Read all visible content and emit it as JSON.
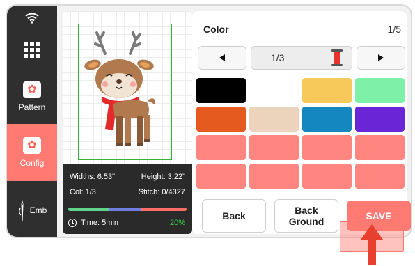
{
  "sidebar": {
    "items": [
      {
        "icon": "wifi-icon"
      },
      {
        "icon": "apps-grid-icon"
      },
      {
        "label": "Pattern",
        "icon": "pattern-icon"
      },
      {
        "label": "Config",
        "icon": "config-icon",
        "active": true
      },
      {
        "label": "Emb",
        "icon": "needle-icon"
      }
    ]
  },
  "info": {
    "width": "Widths: 6.53\"",
    "height": "Height: 3.22\"",
    "col": "Col: 1/3",
    "stitch": "Stitch: 0/4327",
    "time": "Time: 5min",
    "percent": "20%",
    "progress_colors": [
      "#5fd48a",
      "#6f7ee0",
      "#ff6f66"
    ]
  },
  "color_panel": {
    "title": "Color",
    "page": "1/5",
    "thread_counter": "1/3",
    "prev_icon": "triangle-left-icon",
    "next_icon": "triangle-right-icon",
    "thread_icon": "thread-spool-icon",
    "swatches": [
      "#000000",
      "#ffffff",
      "#f7c95a",
      "#7ef0a8",
      "#e55a1e",
      "#ecd3bc",
      "#1487c1",
      "#6a26d6",
      "#ff8580",
      "#ff8580",
      "#ff8580",
      "#ff8580",
      "#ff8580",
      "#ff8580",
      "#ff8580",
      "#ff8580"
    ]
  },
  "actions": {
    "back": "Back",
    "background_line1": "Back",
    "background_line2": "Ground",
    "save": "SAVE"
  },
  "colors": {
    "accent": "#ff7a72",
    "sidebar": "#2f2f2f",
    "hoop": "#36b33a"
  }
}
